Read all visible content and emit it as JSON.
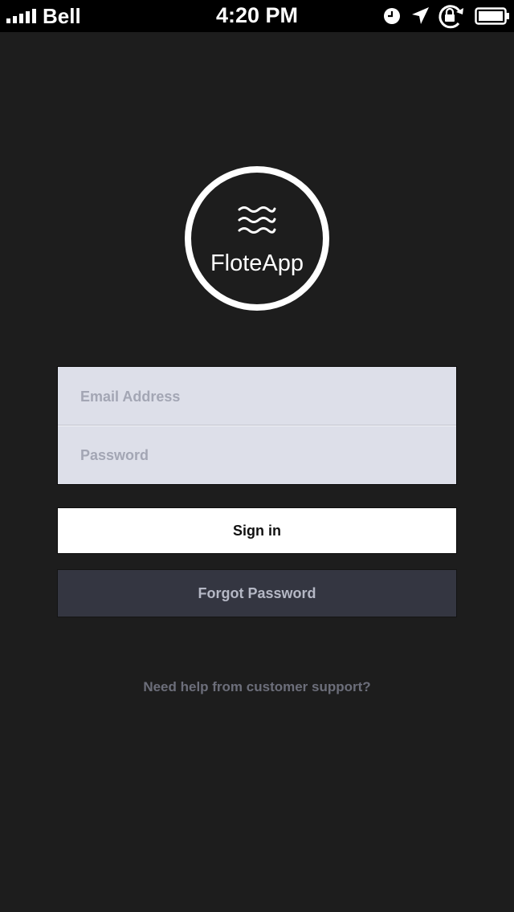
{
  "status_bar": {
    "carrier": "Bell",
    "time": "4:20 PM",
    "icons": [
      "signal-icon",
      "alarm-icon",
      "location-icon",
      "rotation-lock-icon",
      "battery-icon"
    ]
  },
  "logo": {
    "name": "FloteApp",
    "icon": "waves-icon"
  },
  "login_form": {
    "email_placeholder": "Email Address",
    "password_placeholder": "Password"
  },
  "buttons": {
    "sign_in": "Sign in",
    "forgot_password": "Forgot Password"
  },
  "help_link": "Need help from customer support?",
  "colors": {
    "background": "#1d1d1d",
    "status_bar": "#000000",
    "field_background": "#dddfe9",
    "placeholder": "#a3a6b4",
    "sign_in_background": "#ffffff",
    "forgot_background": "#343641",
    "forgot_text": "#b5b8c5",
    "help_text": "#6c6e7a"
  }
}
